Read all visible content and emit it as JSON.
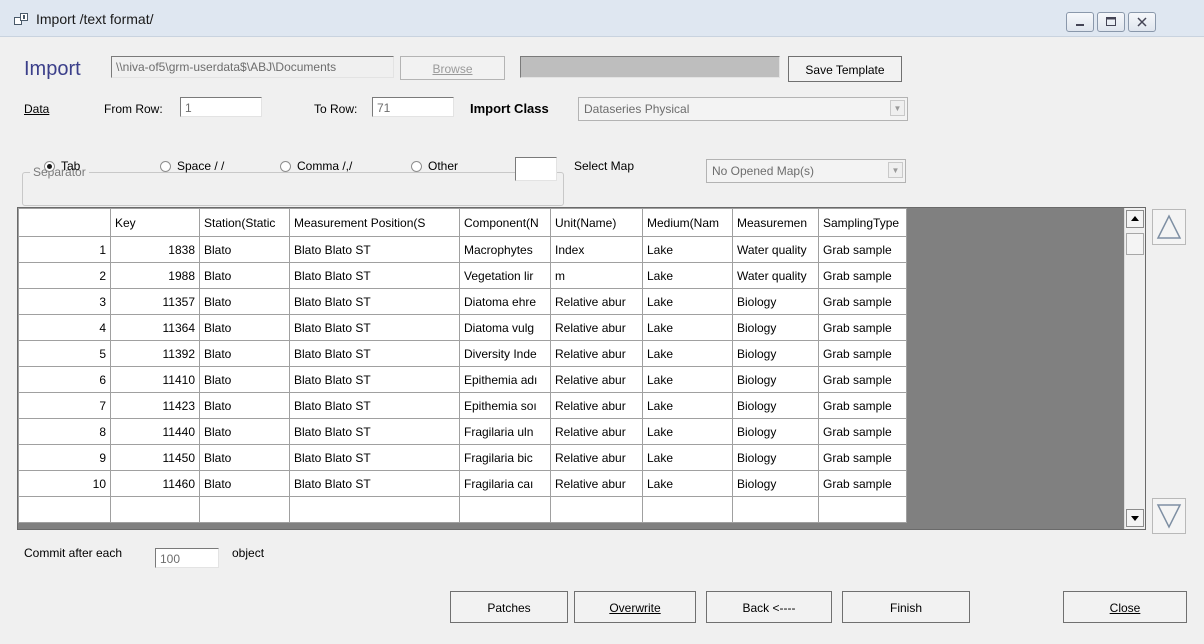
{
  "window": {
    "title": "Import /text format/"
  },
  "header": {
    "import_label": "Import",
    "path_value": "\\\\niva-of5\\grm-userdata$\\ABJ\\Documents",
    "browse_label": "Browse",
    "progress_value": "",
    "save_template_label": "Save Template"
  },
  "rows_bar": {
    "data_link": "Data",
    "from_row_label": "From Row:",
    "from_row_value": "1",
    "to_row_label": "To Row:",
    "to_row_value": "71",
    "import_class_label": "Import Class",
    "import_class_value": "Dataseries Physical"
  },
  "separator": {
    "group_title": "Separator",
    "options": [
      {
        "label": "Tab",
        "selected": true
      },
      {
        "label": "Space / /",
        "selected": false
      },
      {
        "label": "Comma /,/",
        "selected": false
      },
      {
        "label": "Other",
        "selected": false
      }
    ],
    "other_value": "",
    "select_map_label": "Select Map",
    "select_map_value": "No Opened Map(s)"
  },
  "grid": {
    "columns": [
      "",
      "Key",
      "Station(Static",
      "Measurement Position(S",
      "Component(N",
      "Unit(Name)",
      "Medium(Nam",
      "Measuremen",
      "SamplingType"
    ],
    "rows": [
      [
        "1",
        "1838",
        "Blato",
        "Blato Blato ST",
        "Macrophytes",
        "Index",
        "Lake",
        "Water quality",
        "Grab sample"
      ],
      [
        "2",
        "1988",
        "Blato",
        "Blato Blato ST",
        "Vegetation lir",
        "m",
        "Lake",
        "Water quality",
        "Grab sample"
      ],
      [
        "3",
        "11357",
        "Blato",
        "Blato Blato ST",
        "Diatoma ehre",
        "Relative abur",
        "Lake",
        "Biology",
        "Grab sample"
      ],
      [
        "4",
        "11364",
        "Blato",
        "Blato Blato ST",
        "Diatoma vulg",
        "Relative abur",
        "Lake",
        "Biology",
        "Grab sample"
      ],
      [
        "5",
        "11392",
        "Blato",
        "Blato Blato ST",
        "Diversity Inde",
        "Relative abur",
        "Lake",
        "Biology",
        "Grab sample"
      ],
      [
        "6",
        "11410",
        "Blato",
        "Blato Blato ST",
        "Epithemia adı",
        "Relative abur",
        "Lake",
        "Biology",
        "Grab sample"
      ],
      [
        "7",
        "11423",
        "Blato",
        "Blato Blato ST",
        "Epithemia soı",
        "Relative abur",
        "Lake",
        "Biology",
        "Grab sample"
      ],
      [
        "8",
        "11440",
        "Blato",
        "Blato Blato ST",
        "Fragilaria uln",
        "Relative abur",
        "Lake",
        "Biology",
        "Grab sample"
      ],
      [
        "9",
        "11450",
        "Blato",
        "Blato Blato ST",
        "Fragilaria bic",
        "Relative abur",
        "Lake",
        "Biology",
        "Grab sample"
      ],
      [
        "10",
        "11460",
        "Blato",
        "Blato Blato ST",
        "Fragilaria caı",
        "Relative abur",
        "Lake",
        "Biology",
        "Grab sample"
      ]
    ]
  },
  "commit": {
    "label": "Commit after each",
    "value": "100",
    "suffix": "object"
  },
  "buttons": {
    "patches": "Patches",
    "overwrite": "Overwrite",
    "back": "Back <----",
    "finish": "Finish",
    "close": "Close"
  }
}
